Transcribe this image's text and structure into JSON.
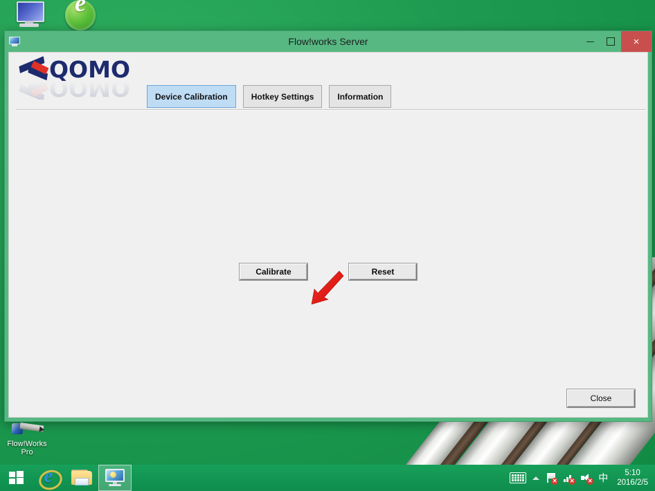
{
  "desktop": {
    "icons": [
      {
        "label": "",
        "name": "my-computer-icon"
      },
      {
        "label": "",
        "name": "green-browser-icon"
      },
      {
        "label": "Flow!Works\nPro",
        "name": "flowworks-pro-icon"
      }
    ],
    "flowworks_label_line1": "Flow!Works",
    "flowworks_label_line2": "Pro"
  },
  "window": {
    "title": "Flow!works Server",
    "controls": {
      "minimize": "–",
      "maximize": "□",
      "close": "×"
    },
    "logo": {
      "word": "QOMO"
    },
    "tabs": [
      {
        "label": "Device Calibration",
        "active": true
      },
      {
        "label": "Hotkey Settings",
        "active": false
      },
      {
        "label": "Information",
        "active": false
      }
    ],
    "calibration": {
      "calibrate_label": "Calibrate",
      "reset_label": "Reset"
    },
    "close_label": "Close"
  },
  "taskbar": {
    "start_name": "start-button",
    "apps": [
      {
        "name": "taskbar-internet-explorer",
        "active": false
      },
      {
        "name": "taskbar-file-explorer",
        "active": false
      },
      {
        "name": "taskbar-flowworks-server",
        "active": true
      }
    ],
    "tray": {
      "ime_char": "中",
      "time": "5:10",
      "date": "2016/2/5"
    }
  },
  "colors": {
    "desktop_green": "#1f9b51",
    "window_frame": "#57b882",
    "close_red": "#c94f4f",
    "active_tab_blue": "#bfdcf5",
    "logo_navy": "#1d2b6e",
    "logo_red": "#e03127",
    "arrow_red": "#e8201a",
    "dialog_gray": "#f0f0f0"
  }
}
